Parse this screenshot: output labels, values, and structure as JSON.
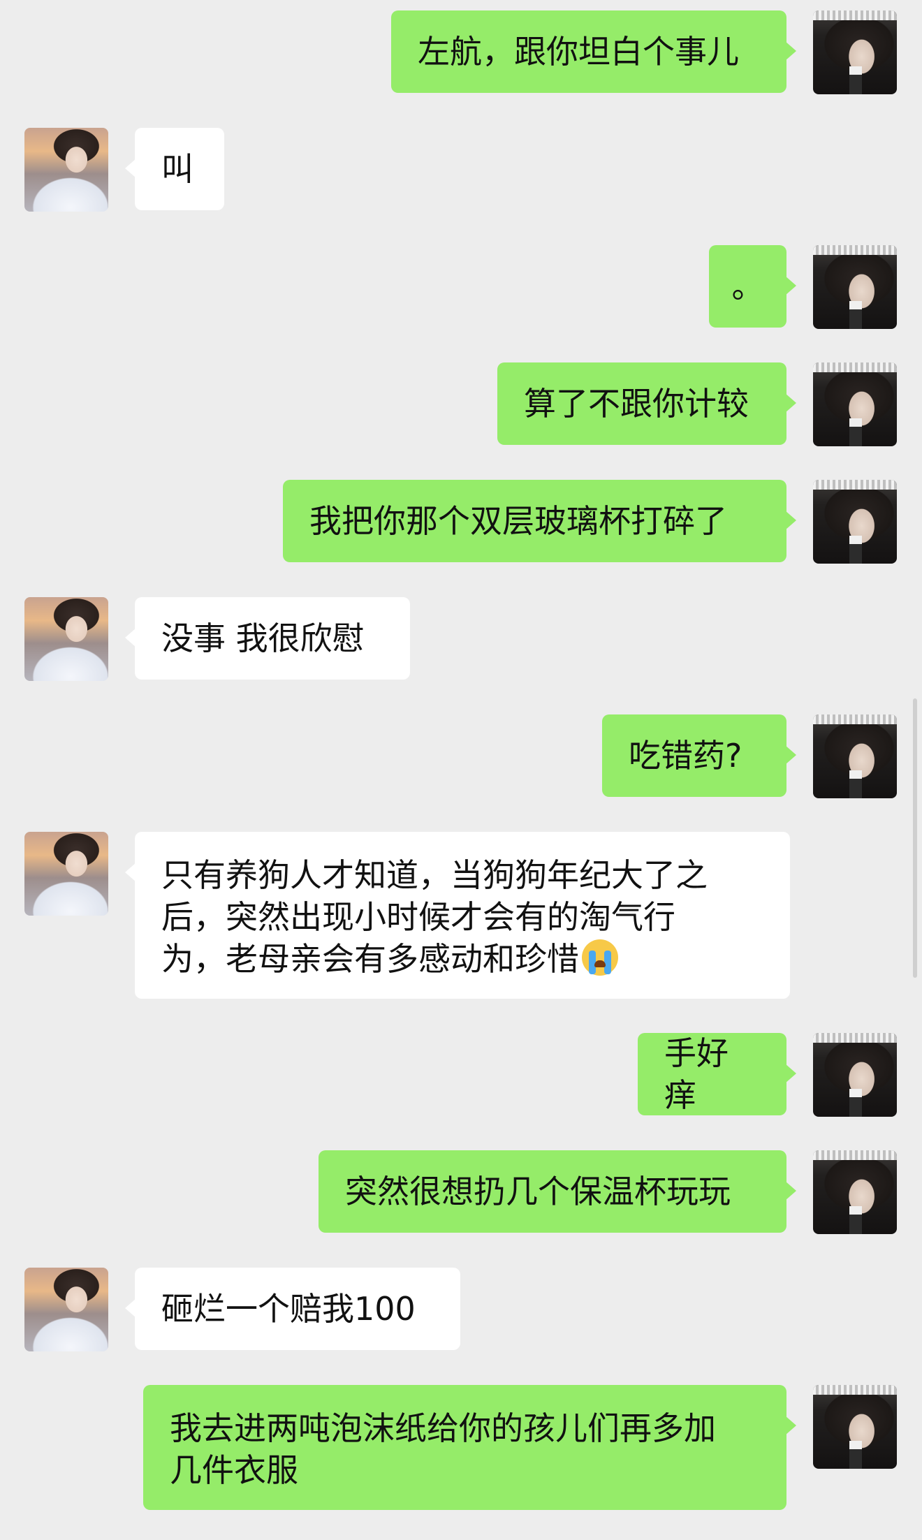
{
  "messages": [
    {
      "sender": "me",
      "text": "左航，跟你坦白个事儿"
    },
    {
      "sender": "them",
      "text": "叫"
    },
    {
      "sender": "me",
      "text": "。"
    },
    {
      "sender": "me",
      "text": "算了不跟你计较"
    },
    {
      "sender": "me",
      "text": "我把你那个双层玻璃杯打碎了"
    },
    {
      "sender": "them",
      "text": "没事 我很欣慰"
    },
    {
      "sender": "me",
      "text": "吃错药?"
    },
    {
      "sender": "them",
      "lines": [
        "只有养狗人才知道，当狗狗年纪大了之",
        "后，突然出现小时候才会有的淘气行",
        "为，老母亲会有多感动和珍惜"
      ],
      "emoji": "loudly-crying-face"
    },
    {
      "sender": "me",
      "text": "手好痒"
    },
    {
      "sender": "me",
      "text": "突然很想扔几个保温杯玩玩"
    },
    {
      "sender": "them",
      "text": "砸烂一个赔我100"
    },
    {
      "sender": "me",
      "lines": [
        "我去进两吨泡沫纸给你的孩儿们再多加",
        "几件衣服"
      ]
    }
  ],
  "colors": {
    "sent_bubble": "#95ec69",
    "received_bubble": "#ffffff",
    "background": "#ededed"
  }
}
